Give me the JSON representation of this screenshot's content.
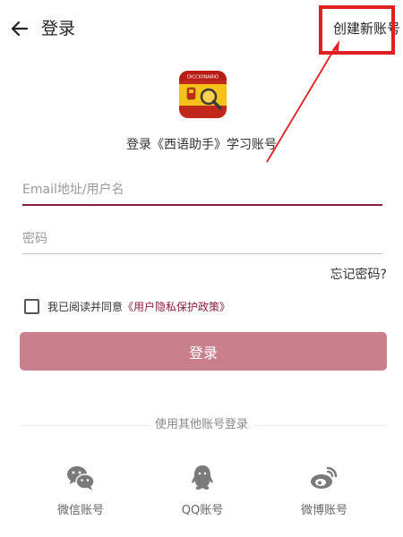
{
  "header": {
    "title": "登录",
    "create_account": "创建新账号"
  },
  "logo": {
    "text": "DICCIONARIO"
  },
  "subtitle": "登录《西语助手》学习账号",
  "form": {
    "username_placeholder": "Email地址/用户名",
    "password_placeholder": "密码",
    "forgot_password": "忘记密码?",
    "agree_prefix": "我已阅读并同意",
    "policy_link": "《用户隐私保护政策》",
    "login_button": "登录"
  },
  "other_login": {
    "label": "使用其他账号登录",
    "options": [
      {
        "label": "微信账号",
        "icon": "wechat-icon"
      },
      {
        "label": "QQ账号",
        "icon": "qq-icon"
      },
      {
        "label": "微博账号",
        "icon": "weibo-icon"
      }
    ]
  },
  "colors": {
    "accent": "#8b1e3f",
    "login_button": "#c9808c",
    "annotation": "#e02020"
  }
}
